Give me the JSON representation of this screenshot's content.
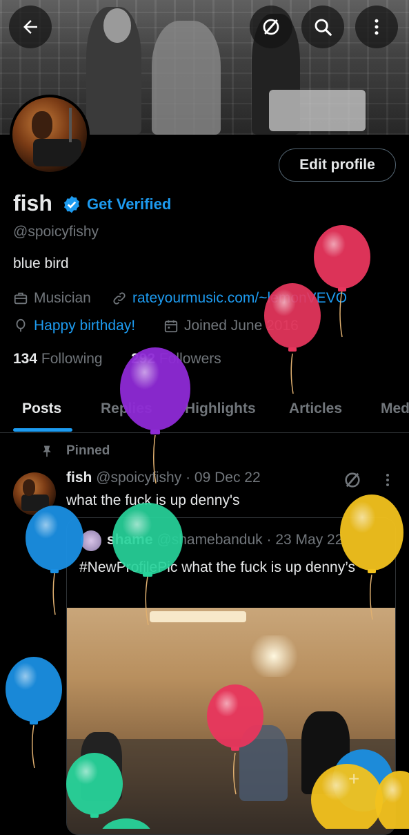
{
  "header": {
    "back_icon": "back-arrow-icon",
    "grok_icon": "slash-circle-icon",
    "search_icon": "search-icon",
    "more_icon": "more-vertical-icon"
  },
  "profile": {
    "edit_label": "Edit profile",
    "name": "fish",
    "get_verified": "Get Verified",
    "handle": "@spoicyfishy",
    "bio": "blue bird",
    "profession": "Musician",
    "website": "rateyourmusic.com/~lemonVEVO",
    "birthday": "Happy birthday!",
    "joined": "Joined June 2016",
    "following_count": "134",
    "following_label": "Following",
    "followers_count": "292",
    "followers_label": "Followers"
  },
  "tabs": [
    "Posts",
    "Replies",
    "Highlights",
    "Articles",
    "Med"
  ],
  "post": {
    "pinned_label": "Pinned",
    "author": "fish",
    "handle": "@spoicyfishy",
    "dot": "·",
    "date": "09 Dec 22",
    "text": "what the fuck is up denny's",
    "quote": {
      "author": "shame",
      "handle": "@shamebanduk",
      "date": "23 May 22",
      "text": "#NewProfilePic what the fuck is up denny’s"
    }
  },
  "colors": {
    "accent": "#1d9bf0",
    "muted": "#71767b",
    "text": "#e7e9ea",
    "balloon_red": "#e8365d",
    "balloon_purple": "#8e2ad6",
    "balloon_blue": "#1a8fe3",
    "balloon_green": "#27d39a",
    "balloon_yellow": "#f2c21d"
  }
}
